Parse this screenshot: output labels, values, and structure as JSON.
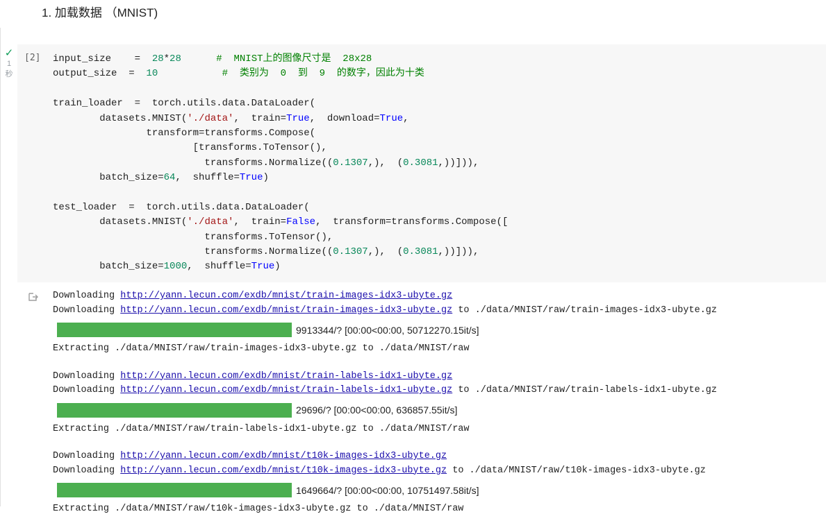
{
  "section": {
    "heading": "1. 加载数据 （MNIST)"
  },
  "cell": {
    "status_icon": "check-icon",
    "exec_time": "1",
    "exec_time_unit": "秒",
    "exec_count": "[2]",
    "code": [
      [
        {
          "t": "input_size    =  "
        },
        {
          "t": "28",
          "c": "num"
        },
        {
          "t": "*"
        },
        {
          "t": "28",
          "c": "num"
        },
        {
          "t": "      "
        },
        {
          "t": "#  MNIST上的图像尺寸是  28x28",
          "c": "cm"
        }
      ],
      [
        {
          "t": "output_size  =  "
        },
        {
          "t": "10",
          "c": "num"
        },
        {
          "t": "           "
        },
        {
          "t": "#  类别为  0  到  9  的数字，因此为十类",
          "c": "cm"
        }
      ],
      [
        {
          "t": ""
        }
      ],
      [
        {
          "t": "train_loader  =  torch.utils.data.DataLoader("
        }
      ],
      [
        {
          "t": "        datasets.MNIST("
        },
        {
          "t": "'./data'",
          "c": "str"
        },
        {
          "t": ",  train="
        },
        {
          "t": "True",
          "c": "kw"
        },
        {
          "t": ",  download="
        },
        {
          "t": "True",
          "c": "kw"
        },
        {
          "t": ","
        }
      ],
      [
        {
          "t": "                transform=transforms.Compose("
        }
      ],
      [
        {
          "t": "                        [transforms.ToTensor(),"
        }
      ],
      [
        {
          "t": "                          transforms.Normalize(("
        },
        {
          "t": "0.1307",
          "c": "num"
        },
        {
          "t": ",),  ("
        },
        {
          "t": "0.3081",
          "c": "num"
        },
        {
          "t": ",))])),"
        }
      ],
      [
        {
          "t": "        batch_size="
        },
        {
          "t": "64",
          "c": "num"
        },
        {
          "t": ",  shuffle="
        },
        {
          "t": "True",
          "c": "kw"
        },
        {
          "t": ")"
        }
      ],
      [
        {
          "t": ""
        }
      ],
      [
        {
          "t": "test_loader  =  torch.utils.data.DataLoader("
        }
      ],
      [
        {
          "t": "        datasets.MNIST("
        },
        {
          "t": "'./data'",
          "c": "str"
        },
        {
          "t": ",  train="
        },
        {
          "t": "False",
          "c": "kw"
        },
        {
          "t": ",  transform=transforms.Compose(["
        }
      ],
      [
        {
          "t": "                          transforms.ToTensor(),"
        }
      ],
      [
        {
          "t": "                          transforms.Normalize(("
        },
        {
          "t": "0.1307",
          "c": "num"
        },
        {
          "t": ",),  ("
        },
        {
          "t": "0.3081",
          "c": "num"
        },
        {
          "t": ",))])),"
        }
      ],
      [
        {
          "t": "        batch_size="
        },
        {
          "t": "1000",
          "c": "num"
        },
        {
          "t": ",  shuffle="
        },
        {
          "t": "True",
          "c": "kw"
        },
        {
          "t": ")"
        }
      ]
    ]
  },
  "output": {
    "icon": "output-icon",
    "downloading_label": "Downloading",
    "to_label": "to",
    "blocks": [
      {
        "url": "http://yann.lecun.com/exdb/mnist/train-images-idx3-ubyte.gz",
        "dest": "./data/MNIST/raw/train-images-idx3-ubyte.gz",
        "progress_text": "9913344/? [00:00<00:00, 50712270.15it/s]",
        "progress_fraction": 1.0,
        "extracting": "Extracting ./data/MNIST/raw/train-images-idx3-ubyte.gz to ./data/MNIST/raw"
      },
      {
        "url": "http://yann.lecun.com/exdb/mnist/train-labels-idx1-ubyte.gz",
        "dest": "./data/MNIST/raw/train-labels-idx1-ubyte.gz",
        "progress_text": "29696/? [00:00<00:00, 636857.55it/s]",
        "progress_fraction": 1.0,
        "extracting": "Extracting ./data/MNIST/raw/train-labels-idx1-ubyte.gz to ./data/MNIST/raw"
      },
      {
        "url": "http://yann.lecun.com/exdb/mnist/t10k-images-idx3-ubyte.gz",
        "dest": "./data/MNIST/raw/t10k-images-idx3-ubyte.gz",
        "progress_text": "1649664/? [00:00<00:00, 10751497.58it/s]",
        "progress_fraction": 1.0,
        "extracting": "Extracting ./data/MNIST/raw/t10k-images-idx3-ubyte.gz to ./data/MNIST/raw"
      }
    ]
  },
  "colors": {
    "progress": "#4caf50",
    "check": "#0f9d58",
    "link": "#1a0dab"
  }
}
